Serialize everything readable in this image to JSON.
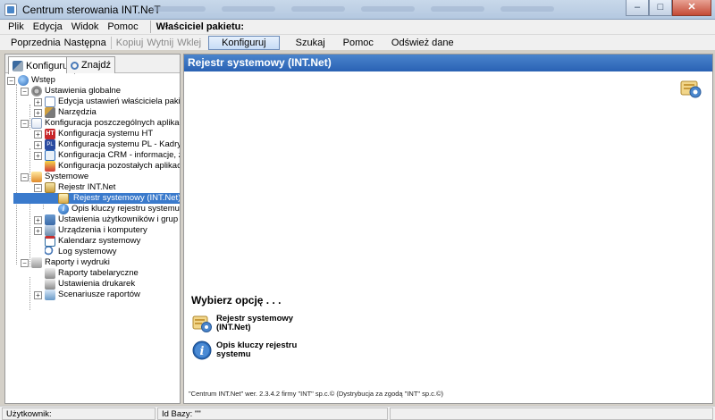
{
  "window": {
    "title": "Centrum sterowania INT.NeT",
    "controls": [
      "–",
      "□",
      "✕"
    ]
  },
  "menu": {
    "items": [
      "Plik",
      "Edycja",
      "Widok",
      "Pomoc"
    ],
    "owner_label": "Właściciel pakietu:"
  },
  "toolbar": {
    "prev": "Poprzednia",
    "next": "Następna",
    "copy": "Kopiuj",
    "cut": "Wytnij",
    "paste": "Wklej",
    "configure": "Konfiguruj",
    "search": "Szukaj",
    "help": "Pomoc",
    "refresh": "Odśwież dane"
  },
  "left_tabs": {
    "configure": "Konfiguruj",
    "find": "Znajdź"
  },
  "tree": {
    "root": "Wstęp",
    "global": "Ustawienia globalne",
    "owner_edit": "Edycja ustawień właściciela pakietu",
    "tools": "Narzędzia",
    "apps_config": "Konfiguracja poszczególnych aplikacji",
    "ht": "Konfiguracja systemu HT",
    "pl": "Konfiguracja systemu PL - Kadry i płac",
    "crm": "Konfiguracja CRM - informacje, zdarze",
    "others": "Konfiguracja pozostałych aplikacji",
    "system": "Systemowe",
    "registry": "Rejestr INT.Net",
    "registry_sys": "Rejestr systemowy (INT.Net)",
    "registry_keys": "Opis kluczy rejestru systemu",
    "users": "Ustawienia użytkowników i grup",
    "devices": "Urządzenia i komputery",
    "calendar": "Kalendarz systemowy",
    "log": "Log systemowy",
    "reports": "Raporty i wydruki",
    "tabular": "Raporty tabelaryczne",
    "printers": "Ustawienia drukarek",
    "scenarios": "Scenariusze raportów"
  },
  "right": {
    "header": "Rejestr systemowy (INT.Net)",
    "choose": "Wybierz opcję . . .",
    "option1": "Rejestr systemowy (INT.Net)",
    "option2": "Opis kluczy rejestru systemu",
    "footer": "\"Centrum INT.Net\" wer. 2.3.4.2 firmy \"INT\" sp.c.© (Dystrybucja za zgodą \"INT\" sp.c.©)"
  },
  "status": {
    "user_label": "Użytkownik:",
    "db_label": "Id Bazy: \"\""
  }
}
